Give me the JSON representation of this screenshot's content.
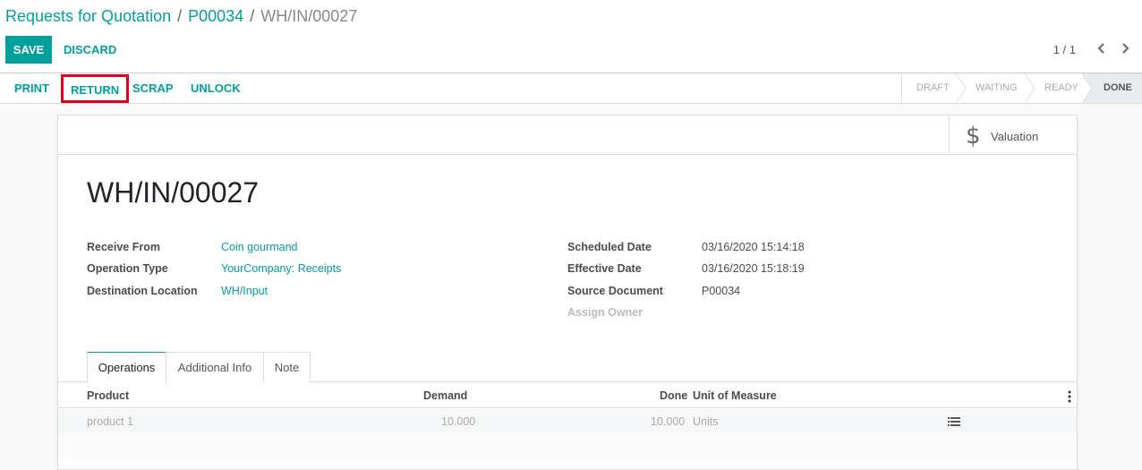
{
  "breadcrumb": {
    "root": "Requests for Quotation",
    "parent": "P00034",
    "current": "WH/IN/00027",
    "separator": "/"
  },
  "controls": {
    "save_label": "SAVE",
    "discard_label": "DISCARD",
    "pager_value": "1 / 1"
  },
  "actions": {
    "print": "PRINT",
    "return": "RETURN",
    "scrap": "SCRAP",
    "unlock": "UNLOCK"
  },
  "stages": {
    "draft": "DRAFT",
    "waiting": "WAITING",
    "ready": "READY",
    "done": "DONE",
    "active": "DONE"
  },
  "smart_buttons": {
    "valuation_label": "Valuation",
    "valuation_icon": "$"
  },
  "record": {
    "title": "WH/IN/00027"
  },
  "fields_left": {
    "receive_from_label": "Receive From",
    "receive_from_value": "Coin gourmand",
    "operation_type_label": "Operation Type",
    "operation_type_value": "YourCompany: Receipts",
    "destination_location_label": "Destination Location",
    "destination_location_value": "WH/Input"
  },
  "fields_right": {
    "scheduled_date_label": "Scheduled Date",
    "scheduled_date_value": "03/16/2020 15:14:18",
    "effective_date_label": "Effective Date",
    "effective_date_value": "03/16/2020 15:18:19",
    "source_document_label": "Source Document",
    "source_document_value": "P00034",
    "assign_owner_label": "Assign Owner"
  },
  "tabs": {
    "operations": "Operations",
    "additional_info": "Additional Info",
    "note": "Note",
    "active": "Operations"
  },
  "table": {
    "headers": {
      "product": "Product",
      "demand": "Demand",
      "done": "Done",
      "uom": "Unit of Measure"
    },
    "rows": [
      {
        "product": "product 1",
        "demand": "10.000",
        "done": "10.000",
        "uom": "Units"
      }
    ]
  },
  "colors": {
    "accent": "#00A09D",
    "highlight_border": "#e6001e",
    "active_stage_bg": "#e9ecef"
  }
}
